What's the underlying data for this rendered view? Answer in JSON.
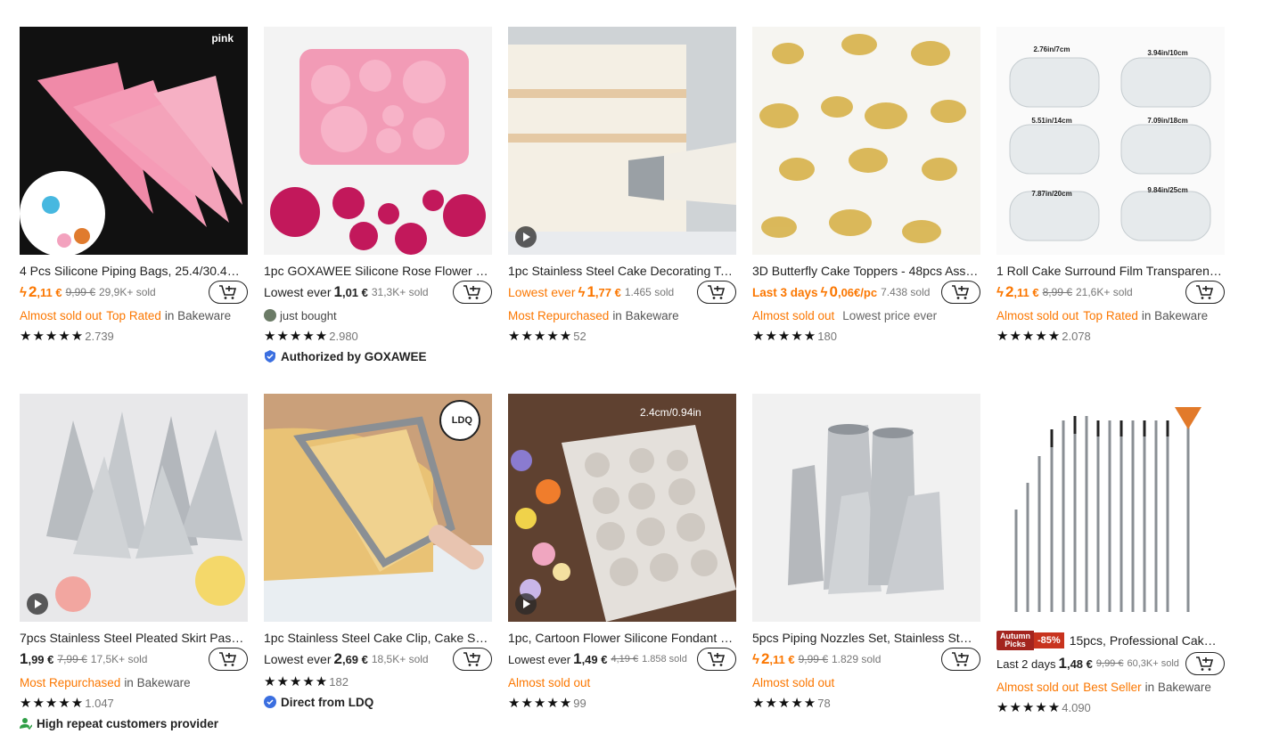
{
  "colors": {
    "accent": "#fb7701",
    "badge": "#c8331e"
  },
  "products": [
    {
      "title": "4 Pcs Silicone Piping Bags, 25.4/30.48/3...",
      "price_int": "2",
      "price_dec": ",11 €",
      "old_price": "9,99 €",
      "sold": "29,9K+ sold",
      "tag1": "Almost sold out",
      "tag2": "Top Rated",
      "tag_in": "in Bakeware",
      "rating_count": "2.739",
      "image_label": "pink"
    },
    {
      "title": "1pc GOXAWEE Silicone Rose Flower Cak...",
      "lowest": "Lowest ever",
      "price_int": "1",
      "price_dec": ",01 €",
      "sold": "31,3K+ sold",
      "bought": "just bought",
      "rating_count": "2.980",
      "extra": "Authorized by GOXAWEE"
    },
    {
      "title": "1pc Stainless Steel Cake Decorating Too...",
      "lowest": "Lowest ever",
      "price_int": "1",
      "price_dec": ",77 €",
      "sold": "1.465 sold",
      "tag1": "Most Repurchased",
      "tag_in": "in Bakeware",
      "rating_count": "52"
    },
    {
      "title": "3D Butterfly Cake Toppers - 48pcs Asso...",
      "lowest": "Last 3 days",
      "price_int": "0",
      "price_dec": ",06€/pc",
      "sold": "7.438 sold",
      "tag1": "Almost sold out",
      "tag_plain": "Lowest price ever",
      "rating_count": "180"
    },
    {
      "title": "1 Roll Cake Surround Film Transparent ...",
      "price_int": "2",
      "price_dec": ",11 €",
      "old_price": "8,99 €",
      "sold": "21,6K+ sold",
      "tag1": "Almost sold out",
      "tag2": "Top Rated",
      "tag_in": "in Bakeware",
      "rating_count": "2.078",
      "film_labels": [
        "2.76in/7cm",
        "3.94in/10cm",
        "5.51in/14cm",
        "7.09in/18cm",
        "7.87in/20cm",
        "9.84in/25cm"
      ]
    },
    {
      "title": "7pcs Stainless Steel Pleated Skirt Pastry ...",
      "price_int": "1",
      "price_dec": ",99 €",
      "old_price": "7,99 €",
      "sold": "17,5K+ sold",
      "tag1": "Most Repurchased",
      "tag_in": "in Bakeware",
      "rating_count": "1.047",
      "extra": "High repeat customers provider"
    },
    {
      "title": "1pc Stainless Steel Cake Clip, Cake Slice...",
      "lowest": "Lowest ever",
      "price_int": "2",
      "price_dec": ",69 €",
      "sold": "18,5K+ sold",
      "rating_count": "182",
      "extra": "Direct from LDQ",
      "image_label": "LDQ"
    },
    {
      "title": "1pc, Cartoon Flower Silicone Fondant C...",
      "lowest": "Lowest ever",
      "price_int": "1",
      "price_dec": ",49 €",
      "old_price": "4,19 €",
      "sold": "1.858 sold",
      "tag1": "Almost sold out",
      "rating_count": "99",
      "image_label": "2.4cm/0.94in"
    },
    {
      "title": "5pcs Piping Nozzles Set, Stainless Steel ...",
      "price_int": "2",
      "price_dec": ",11 €",
      "old_price": "9,99 €",
      "sold": "1.829 sold",
      "tag1": "Almost sold out",
      "rating_count": "78"
    },
    {
      "title": "15pcs, Professional Cake D...",
      "badge_top": "Autumn",
      "badge_bottom": "Picks",
      "badge_pct": "-85%",
      "lowest": "Last 2 days",
      "price_int": "1",
      "price_dec": ",48 €",
      "old_price": "9,99 €",
      "sold": "60,3K+ sold",
      "tag1": "Almost sold out",
      "tag2": "Best Seller",
      "tag_in": "in Bakeware",
      "rating_count": "4.090"
    }
  ]
}
